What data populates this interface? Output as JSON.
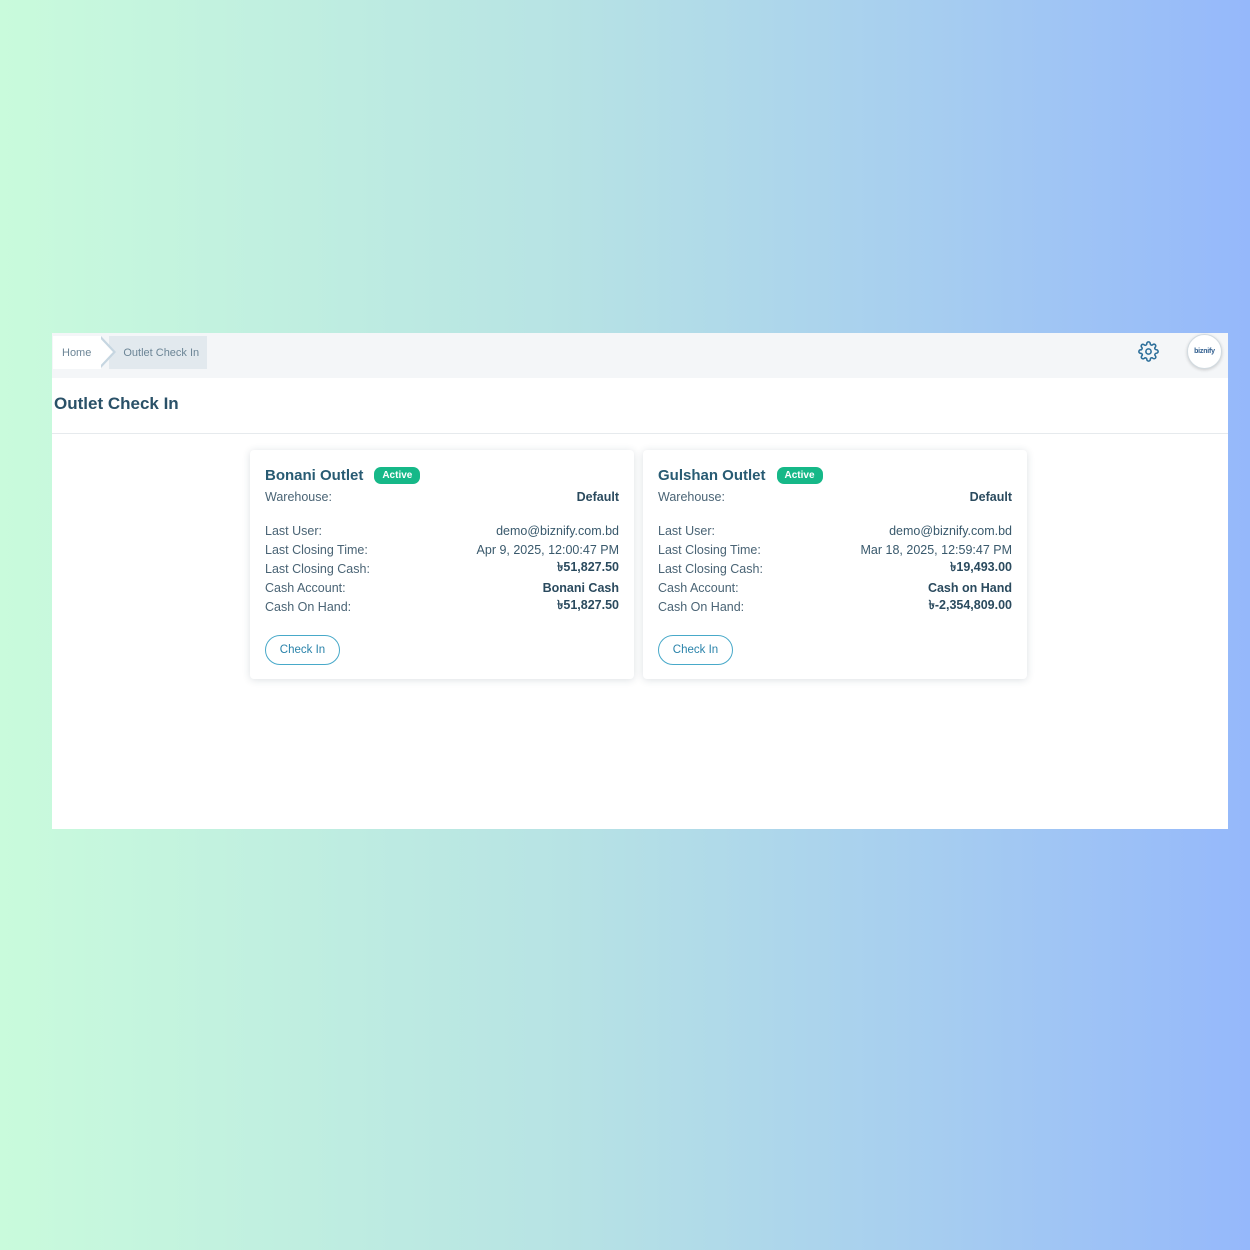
{
  "breadcrumb": {
    "home": "Home",
    "current": "Outlet Check In"
  },
  "header": {
    "settings_icon": "gear-icon",
    "avatar_logo": "biznify"
  },
  "page": {
    "title": "Outlet Check In"
  },
  "colors": {
    "accent": "#2a83aa",
    "badge_active": "#16b888",
    "title_text": "#285b73"
  },
  "outlets": [
    {
      "name": "Bonani Outlet",
      "status": "Active",
      "warehouse_label": "Warehouse:",
      "warehouse": "Default",
      "last_user_label": "Last User:",
      "last_user": "demo@biznify.com.bd",
      "last_closing_time_label": "Last Closing Time:",
      "last_closing_time": "Apr 9, 2025, 12:00:47 PM",
      "last_closing_cash_label": "Last Closing Cash:",
      "last_closing_cash": "৳51,827.50",
      "cash_account_label": "Cash Account:",
      "cash_account": "Bonani Cash",
      "cash_on_hand_label": "Cash On Hand:",
      "cash_on_hand": "৳51,827.50",
      "button_label": "Check In"
    },
    {
      "name": "Gulshan Outlet",
      "status": "Active",
      "warehouse_label": "Warehouse:",
      "warehouse": "Default",
      "last_user_label": "Last User:",
      "last_user": "demo@biznify.com.bd",
      "last_closing_time_label": "Last Closing Time:",
      "last_closing_time": "Mar 18, 2025, 12:59:47 PM",
      "last_closing_cash_label": "Last Closing Cash:",
      "last_closing_cash": "৳19,493.00",
      "cash_account_label": "Cash Account:",
      "cash_account": "Cash on Hand",
      "cash_on_hand_label": "Cash On Hand:",
      "cash_on_hand": "৳-2,354,809.00",
      "button_label": "Check In"
    }
  ]
}
